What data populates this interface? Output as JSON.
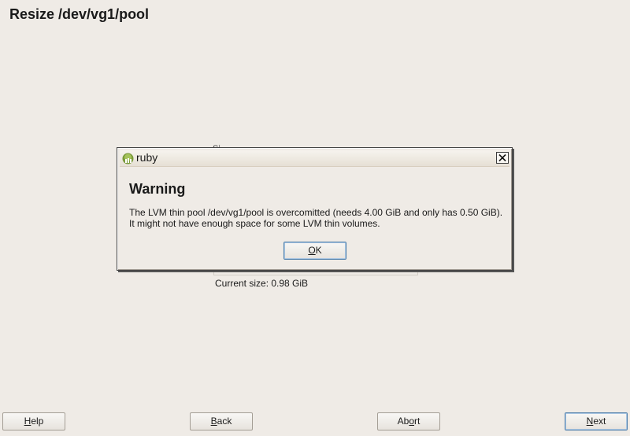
{
  "page": {
    "title": "Resize /dev/vg1/pool",
    "partial_label": "Si",
    "current_size": "Current size: 0.98 GiB"
  },
  "buttons": {
    "help": {
      "mnemonic": "H",
      "rest": "elp"
    },
    "back": {
      "mnemonic": "B",
      "rest": "ack"
    },
    "abort": {
      "pre": "Ab",
      "mnemonic": "o",
      "rest": "rt"
    },
    "next": {
      "mnemonic": "N",
      "rest": "ext"
    }
  },
  "dialog": {
    "window_title": "ruby",
    "heading": "Warning",
    "message_line1": "The LVM thin pool /dev/vg1/pool is overcomitted (needs 4.00 GiB and only has 0.50 GiB).",
    "message_line2": "It might not have enough space for some LVM thin volumes.",
    "ok": {
      "mnemonic": "O",
      "rest": "K"
    },
    "icon": "ruby-icon",
    "close_icon": "close-icon"
  }
}
